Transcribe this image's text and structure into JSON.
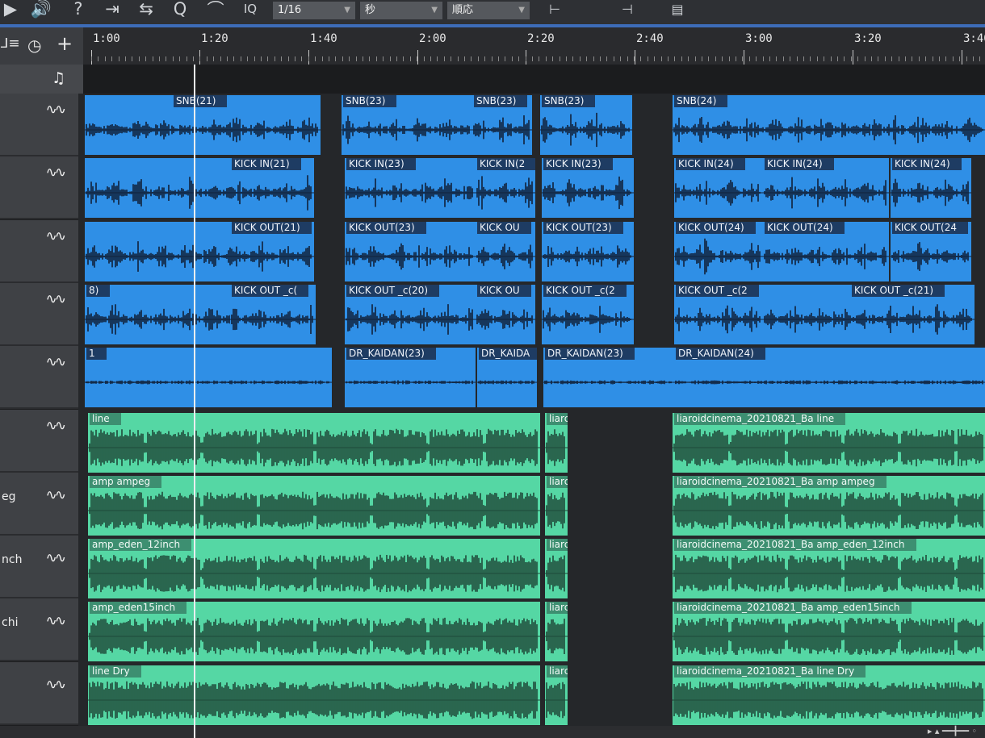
{
  "toolbar": {
    "icons": [
      "speaker-icon",
      "help-icon",
      "follow-icon",
      "loop-icon",
      "q-icon",
      "wifi-icon",
      "iq-icon"
    ],
    "quantize": "1/16",
    "timebase": "秒",
    "snap_mode": "順応",
    "iq_label": "IQ"
  },
  "ruler": {
    "ticks": [
      "1:00",
      "1:20",
      "1:40",
      "2:00",
      "2:20",
      "2:40",
      "3:00",
      "3:20",
      "3:40"
    ]
  },
  "tracks": [
    {
      "name": ""
    },
    {
      "name": ""
    },
    {
      "name": ""
    },
    {
      "name": ""
    },
    {
      "name": ""
    },
    {
      "name": ""
    },
    {
      "name": "eg"
    },
    {
      "name": "nch"
    },
    {
      "name": "chi"
    },
    {
      "name": ""
    }
  ],
  "clips": {
    "row0": [
      "SNB(21)",
      "SNB(23)",
      "SNB(23)",
      "SNB(23)",
      "SNB(24)"
    ],
    "row1": [
      "KICK IN(21)",
      "KICK IN(23)",
      "KICK IN(2",
      "KICK IN(23)",
      "KICK IN(24)",
      "KICK IN(24)",
      "KICK IN(24)"
    ],
    "row2": [
      "KICK OUT(21)",
      "KICK OUT(23)",
      "KICK OU",
      "KICK OUT(23)",
      "KICK OUT(24)",
      "KICK OUT(24)",
      "KICK OUT(24"
    ],
    "row3": [
      "8)",
      "KICK OUT _c(",
      "KICK OUT _c(20)",
      "KICK OU",
      "KICK OUT _c(2",
      "KICK OUT _c(2",
      "KICK OUT _c(21)"
    ],
    "row4": [
      "1",
      "DR_KAIDAN(23)",
      "DR_KAIDA",
      "DR_KAIDAN(23)",
      "DR_KAIDAN(24)"
    ],
    "row5": [
      "line",
      "liarc",
      "liaroidcinema_20210821_Ba line"
    ],
    "row6": [
      "amp ampeg",
      "liarc",
      "liaroidcinema_20210821_Ba amp ampeg"
    ],
    "row7": [
      "amp_eden_12inch",
      "liarc",
      "liaroidcinema_20210821_Ba amp_eden_12inch"
    ],
    "row8": [
      "amp_eden15inch",
      "liarc",
      "liaroidcinema_20210821_Ba amp_eden15inch"
    ],
    "row9": [
      "line Dry",
      "liarc",
      "liaroidcinema_20210821_Ba line Dry"
    ]
  },
  "colors": {
    "drum_clip": "#2f8fe6",
    "bass_clip": "#55d7a4",
    "waveform_drum": "#10213a",
    "waveform_bass": "#1f4a3a",
    "accent": "#3d6cb8"
  }
}
